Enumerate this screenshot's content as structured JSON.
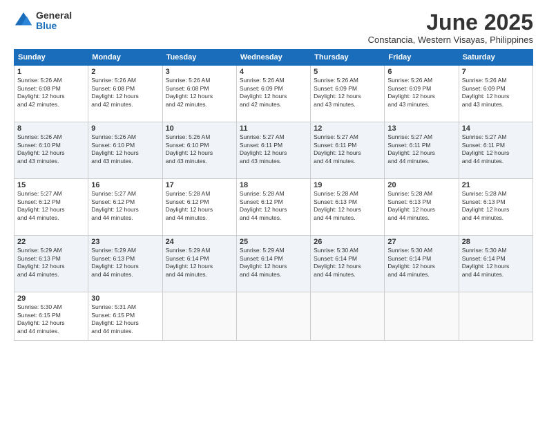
{
  "header": {
    "logo_general": "General",
    "logo_blue": "Blue",
    "month_title": "June 2025",
    "location": "Constancia, Western Visayas, Philippines"
  },
  "weekdays": [
    "Sunday",
    "Monday",
    "Tuesday",
    "Wednesday",
    "Thursday",
    "Friday",
    "Saturday"
  ],
  "weeks": [
    [
      {
        "day": "1",
        "sunrise": "5:26 AM",
        "sunset": "6:08 PM",
        "daylight": "12 hours and 42 minutes."
      },
      {
        "day": "2",
        "sunrise": "5:26 AM",
        "sunset": "6:08 PM",
        "daylight": "12 hours and 42 minutes."
      },
      {
        "day": "3",
        "sunrise": "5:26 AM",
        "sunset": "6:08 PM",
        "daylight": "12 hours and 42 minutes."
      },
      {
        "day": "4",
        "sunrise": "5:26 AM",
        "sunset": "6:09 PM",
        "daylight": "12 hours and 42 minutes."
      },
      {
        "day": "5",
        "sunrise": "5:26 AM",
        "sunset": "6:09 PM",
        "daylight": "12 hours and 43 minutes."
      },
      {
        "day": "6",
        "sunrise": "5:26 AM",
        "sunset": "6:09 PM",
        "daylight": "12 hours and 43 minutes."
      },
      {
        "day": "7",
        "sunrise": "5:26 AM",
        "sunset": "6:09 PM",
        "daylight": "12 hours and 43 minutes."
      }
    ],
    [
      {
        "day": "8",
        "sunrise": "5:26 AM",
        "sunset": "6:10 PM",
        "daylight": "12 hours and 43 minutes."
      },
      {
        "day": "9",
        "sunrise": "5:26 AM",
        "sunset": "6:10 PM",
        "daylight": "12 hours and 43 minutes."
      },
      {
        "day": "10",
        "sunrise": "5:26 AM",
        "sunset": "6:10 PM",
        "daylight": "12 hours and 43 minutes."
      },
      {
        "day": "11",
        "sunrise": "5:27 AM",
        "sunset": "6:11 PM",
        "daylight": "12 hours and 43 minutes."
      },
      {
        "day": "12",
        "sunrise": "5:27 AM",
        "sunset": "6:11 PM",
        "daylight": "12 hours and 44 minutes."
      },
      {
        "day": "13",
        "sunrise": "5:27 AM",
        "sunset": "6:11 PM",
        "daylight": "12 hours and 44 minutes."
      },
      {
        "day": "14",
        "sunrise": "5:27 AM",
        "sunset": "6:11 PM",
        "daylight": "12 hours and 44 minutes."
      }
    ],
    [
      {
        "day": "15",
        "sunrise": "5:27 AM",
        "sunset": "6:12 PM",
        "daylight": "12 hours and 44 minutes."
      },
      {
        "day": "16",
        "sunrise": "5:27 AM",
        "sunset": "6:12 PM",
        "daylight": "12 hours and 44 minutes."
      },
      {
        "day": "17",
        "sunrise": "5:28 AM",
        "sunset": "6:12 PM",
        "daylight": "12 hours and 44 minutes."
      },
      {
        "day": "18",
        "sunrise": "5:28 AM",
        "sunset": "6:12 PM",
        "daylight": "12 hours and 44 minutes."
      },
      {
        "day": "19",
        "sunrise": "5:28 AM",
        "sunset": "6:13 PM",
        "daylight": "12 hours and 44 minutes."
      },
      {
        "day": "20",
        "sunrise": "5:28 AM",
        "sunset": "6:13 PM",
        "daylight": "12 hours and 44 minutes."
      },
      {
        "day": "21",
        "sunrise": "5:28 AM",
        "sunset": "6:13 PM",
        "daylight": "12 hours and 44 minutes."
      }
    ],
    [
      {
        "day": "22",
        "sunrise": "5:29 AM",
        "sunset": "6:13 PM",
        "daylight": "12 hours and 44 minutes."
      },
      {
        "day": "23",
        "sunrise": "5:29 AM",
        "sunset": "6:13 PM",
        "daylight": "12 hours and 44 minutes."
      },
      {
        "day": "24",
        "sunrise": "5:29 AM",
        "sunset": "6:14 PM",
        "daylight": "12 hours and 44 minutes."
      },
      {
        "day": "25",
        "sunrise": "5:29 AM",
        "sunset": "6:14 PM",
        "daylight": "12 hours and 44 minutes."
      },
      {
        "day": "26",
        "sunrise": "5:30 AM",
        "sunset": "6:14 PM",
        "daylight": "12 hours and 44 minutes."
      },
      {
        "day": "27",
        "sunrise": "5:30 AM",
        "sunset": "6:14 PM",
        "daylight": "12 hours and 44 minutes."
      },
      {
        "day": "28",
        "sunrise": "5:30 AM",
        "sunset": "6:14 PM",
        "daylight": "12 hours and 44 minutes."
      }
    ],
    [
      {
        "day": "29",
        "sunrise": "5:30 AM",
        "sunset": "6:15 PM",
        "daylight": "12 hours and 44 minutes."
      },
      {
        "day": "30",
        "sunrise": "5:31 AM",
        "sunset": "6:15 PM",
        "daylight": "12 hours and 44 minutes."
      },
      null,
      null,
      null,
      null,
      null
    ]
  ],
  "labels": {
    "sunrise": "Sunrise:",
    "sunset": "Sunset:",
    "daylight": "Daylight:"
  }
}
